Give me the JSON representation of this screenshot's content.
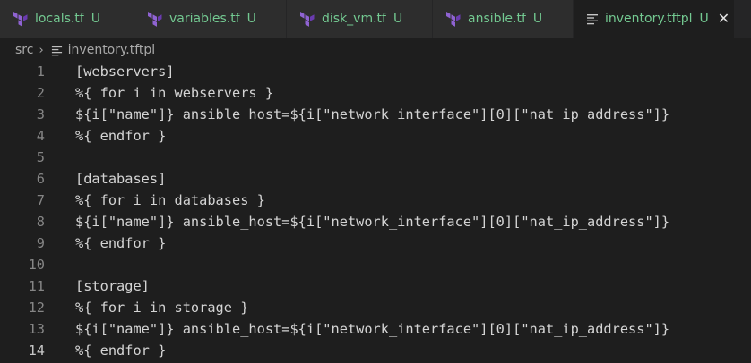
{
  "tabs": [
    {
      "label": "locals.tf",
      "status": "U",
      "icon": "terraform-icon",
      "active": false
    },
    {
      "label": "variables.tf",
      "status": "U",
      "icon": "terraform-icon",
      "active": false
    },
    {
      "label": "disk_vm.tf",
      "status": "U",
      "icon": "terraform-icon",
      "active": false
    },
    {
      "label": "ansible.tf",
      "status": "U",
      "icon": "terraform-icon",
      "active": false
    },
    {
      "label": "inventory.tftpl",
      "status": "U",
      "icon": "lines-icon",
      "active": true,
      "close": "✕"
    }
  ],
  "breadcrumb": {
    "folder": "src",
    "separator": "›",
    "file": "inventory.tftpl"
  },
  "editor": {
    "current_line": 14,
    "lines": [
      {
        "number": "1",
        "text": "[webservers]"
      },
      {
        "number": "2",
        "text": "%{ for i in webservers }"
      },
      {
        "number": "3",
        "text": "${i[\"name\"]} ansible_host=${i[\"network_interface\"][0][\"nat_ip_address\"]}"
      },
      {
        "number": "4",
        "text": "%{ endfor }"
      },
      {
        "number": "5",
        "text": ""
      },
      {
        "number": "6",
        "text": "[databases]"
      },
      {
        "number": "7",
        "text": "%{ for i in databases }"
      },
      {
        "number": "8",
        "text": "${i[\"name\"]} ansible_host=${i[\"network_interface\"][0][\"nat_ip_address\"]}"
      },
      {
        "number": "9",
        "text": "%{ endfor }"
      },
      {
        "number": "10",
        "text": ""
      },
      {
        "number": "11",
        "text": "[storage]"
      },
      {
        "number": "12",
        "text": "%{ for i in storage }"
      },
      {
        "number": "13",
        "text": "${i[\"name\"]} ansible_host=${i[\"network_interface\"][0][\"nat_ip_address\"]}"
      },
      {
        "number": "14",
        "text": "%{ endfor }"
      }
    ]
  },
  "colors": {
    "background": "#1e1e1e",
    "tab_inactive": "#2d2d2d",
    "untracked_green": "#73c991",
    "terraform_purple": "#7b42bc"
  }
}
